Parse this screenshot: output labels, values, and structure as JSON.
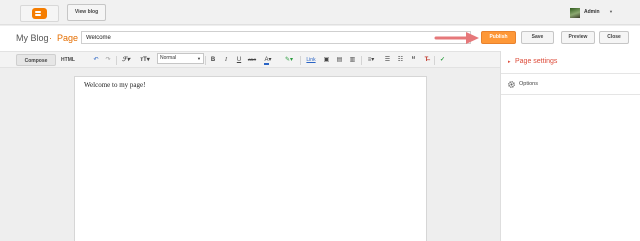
{
  "topbar": {
    "logo_icon": "blogger-logo-icon",
    "view_blog_label": "View blog",
    "user_name": "Admin",
    "user_menu_icon": "caret-down-icon"
  },
  "titlebar": {
    "blog_name": "My Blog",
    "separator": "·",
    "page_label": "Page",
    "title_value": "Welcome",
    "publish_label": "Publish",
    "save_label": "Save",
    "preview_label": "Preview",
    "close_label": "Close",
    "accent_color": "#fe9838",
    "annotation": "arrow pointing to Publish button"
  },
  "toolbar": {
    "compose_label": "Compose",
    "html_label": "HTML",
    "font_select_value": "Normal",
    "link_label": "Link",
    "icons": [
      "undo-icon",
      "redo-icon",
      "font-family-icon",
      "font-size-icon",
      "bold-icon",
      "italic-icon",
      "underline-icon",
      "strikethrough-icon",
      "text-color-icon",
      "highlight-icon",
      "link-icon",
      "image-icon",
      "video-icon",
      "jump-break-icon",
      "align-icon",
      "numbered-list-icon",
      "bulleted-list-icon",
      "quote-icon",
      "remove-formatting-icon",
      "spellcheck-icon"
    ]
  },
  "editor": {
    "content": "Welcome to my page!"
  },
  "sidebar": {
    "title": "Page settings",
    "title_color": "#dd4b39",
    "options_label": "Options"
  }
}
